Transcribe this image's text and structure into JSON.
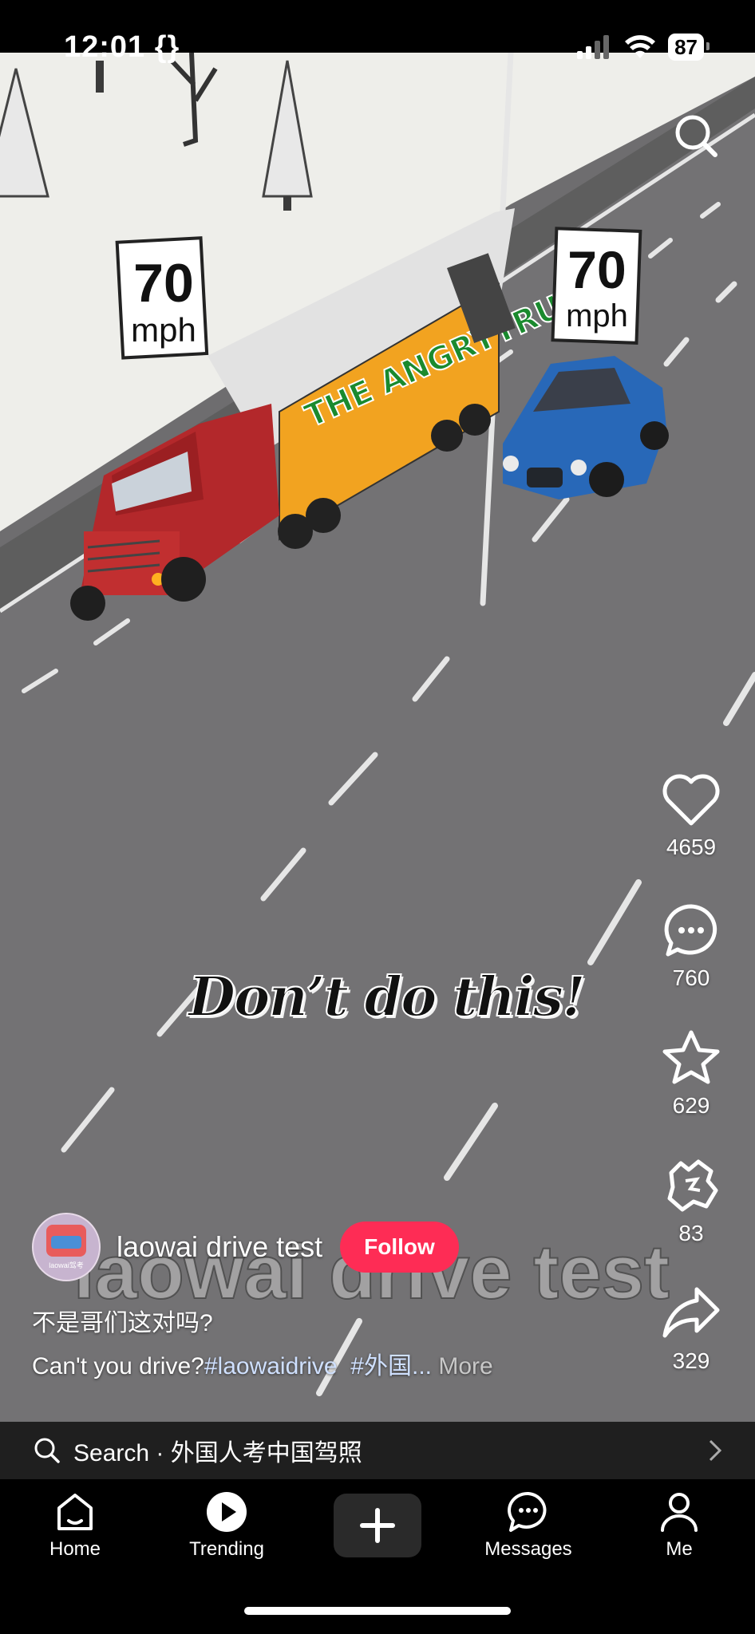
{
  "status_bar": {
    "time": "12:01 {}",
    "battery": "87"
  },
  "video": {
    "caption": "Don’t do this!",
    "watermark": "laowai drive test",
    "speed_signs": [
      {
        "value": "70",
        "unit": "mph"
      },
      {
        "value": "70",
        "unit": "mph"
      }
    ],
    "truck_text": "THE ANGRYTRUCK"
  },
  "actions": {
    "likes": "4659",
    "comments": "760",
    "favorites": "629",
    "fourth": "83",
    "shares": "329"
  },
  "author": {
    "name": "laowai drive test",
    "follow_label": "Follow",
    "avatar_text": "laowai驾考"
  },
  "description": {
    "line1": "不是哥们这对吗?",
    "text": "Can't you drive?",
    "hashtag1": "#laowaidrive",
    "hashtag2": "#外国...",
    "more": "More"
  },
  "search": {
    "label": "Search · 外国人考中国驾照"
  },
  "nav": {
    "home": "Home",
    "trending": "Trending",
    "messages": "Messages",
    "me": "Me"
  },
  "colors": {
    "follow": "#fe2c55",
    "accent_hashtag": "#cfe0ff"
  }
}
